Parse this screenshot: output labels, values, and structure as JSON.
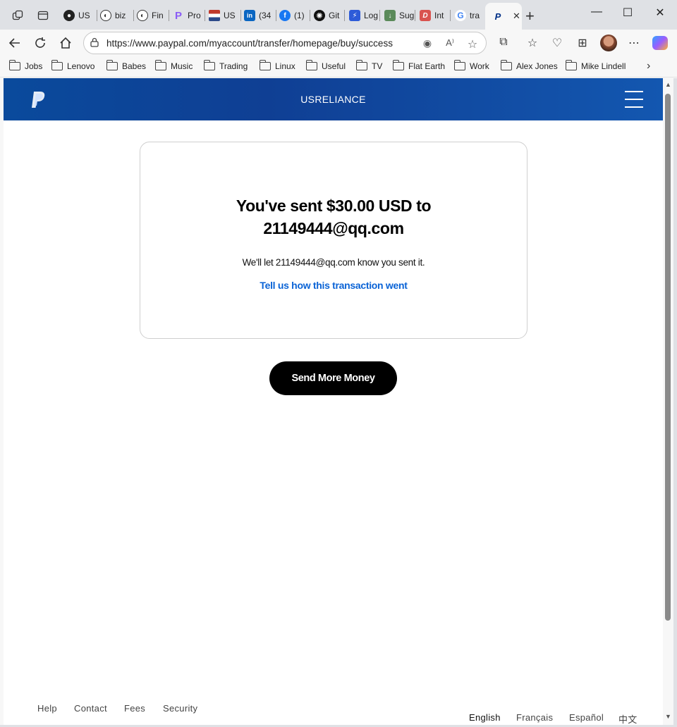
{
  "browser": {
    "tabs": [
      {
        "title": "US",
        "icon": "seal-icon",
        "color": "#222222"
      },
      {
        "title": "biz",
        "icon": "github-icon",
        "color": "#222222"
      },
      {
        "title": "Fin",
        "icon": "github-icon",
        "color": "#222222"
      },
      {
        "title": "Pro",
        "icon": "p-logo-icon",
        "color": "#8a5cf6"
      },
      {
        "title": "US",
        "icon": "flag-icon",
        "color": "#c0392b"
      },
      {
        "title": "(34",
        "icon": "linkedin-icon",
        "color": "#0a66c2"
      },
      {
        "title": "(1)",
        "icon": "facebook-icon",
        "color": "#1877f2"
      },
      {
        "title": "Git",
        "icon": "openai-icon",
        "color": "#111111"
      },
      {
        "title": "Log",
        "icon": "bolt-icon",
        "color": "#2d5bd8"
      },
      {
        "title": "Sug",
        "icon": "download-icon",
        "color": "#5a8a5a"
      },
      {
        "title": "Int",
        "icon": "d-logo-icon",
        "color": "#d9534f"
      },
      {
        "title": "tra",
        "icon": "google-icon",
        "color": "#4285f4"
      },
      {
        "title": "",
        "icon": "paypal-icon",
        "color": "#003087",
        "active": true
      }
    ],
    "url": "https://www.paypal.com/myaccount/transfer/homepage/buy/success",
    "bookmarks": [
      "Jobs",
      "Lenovo",
      "Babes",
      "Music",
      "Trading",
      "Linux",
      "Useful",
      "TV",
      "Flat Earth",
      "Work",
      "Alex Jones",
      "Mike Lindell"
    ]
  },
  "page": {
    "merchant": "USRELIANCE",
    "title_line1": "You've sent $30.00 USD to",
    "title_line2": "21149444@qq.com",
    "subtitle": "We'll let 21149444@qq.com know you sent it.",
    "feedback_link": "Tell us how this transaction went",
    "send_more_button": "Send More Money",
    "footer_links": [
      "Help",
      "Contact",
      "Fees",
      "Security"
    ],
    "languages": [
      "English",
      "Français",
      "Español",
      "中文"
    ]
  },
  "colors": {
    "header_blue": "#0f3f94",
    "link_blue": "#0a63d6",
    "button_black": "#000000"
  }
}
